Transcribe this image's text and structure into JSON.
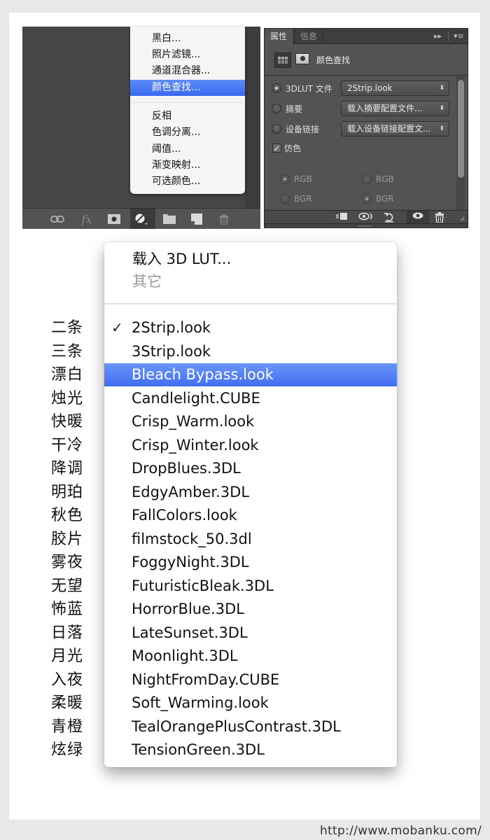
{
  "adjustment_menu": {
    "items_top": [
      "黑白...",
      "照片滤镜...",
      "通道混合器...",
      "颜色查找..."
    ],
    "selected": "颜色查找...",
    "items_bottom": [
      "反相",
      "色调分离...",
      "阈值...",
      "渐变映射...",
      "可选颜色..."
    ]
  },
  "layers_toolbar": {
    "icons": [
      "link-icon",
      "fx-icon",
      "mask-icon",
      "adjustment-icon",
      "folder-icon",
      "new-layer-icon",
      "trash-icon"
    ],
    "fx_label": "fx"
  },
  "properties_panel": {
    "tabs": [
      "属性",
      "信息"
    ],
    "active_tab": "属性",
    "title": "颜色查找",
    "rows": [
      {
        "label": "3DLUT 文件",
        "value": "2Strip.look",
        "selected": true
      },
      {
        "label": "摘要",
        "value": "载入摘要配置文件...",
        "selected": false
      },
      {
        "label": "设备链接",
        "value": "载入设备链接配置文...",
        "selected": false
      }
    ],
    "dither_label": "仿色",
    "dither_checked": true,
    "order_left": [
      {
        "label": "RGB",
        "selected": true
      },
      {
        "label": "BGR",
        "selected": false
      }
    ],
    "order_right": [
      {
        "label": "RGB",
        "selected": false
      },
      {
        "label": "BGR",
        "selected": true
      }
    ],
    "select_arrows": "⬍"
  },
  "lut_dropdown": {
    "load_label": "载入 3D LUT...",
    "other_label": "其它",
    "checked": "2Strip.look",
    "highlighted": "Bleach Bypass.look",
    "items": [
      "2Strip.look",
      "3Strip.look",
      "Bleach Bypass.look",
      "Candlelight.CUBE",
      "Crisp_Warm.look",
      "Crisp_Winter.look",
      "DropBlues.3DL",
      "EdgyAmber.3DL",
      "FallColors.look",
      "filmstock_50.3dl",
      "FoggyNight.3DL",
      "FuturisticBleak.3DL",
      "HorrorBlue.3DL",
      "LateSunset.3DL",
      "Moonlight.3DL",
      "NightFromDay.CUBE",
      "Soft_Warming.look",
      "TealOrangePlusContrast.3DL",
      "TensionGreen.3DL"
    ]
  },
  "chinese_names": [
    "二条",
    "三条",
    "漂白",
    "烛光",
    "快暖",
    "干冷",
    "降调",
    "明珀",
    "秋色",
    "胶片",
    "雾夜",
    "无望",
    "怖蓝",
    "日落",
    "月光",
    "入夜",
    "柔暖",
    "青橙",
    "炫绿"
  ],
  "footer": {
    "url": "http://www.mobanku.com/"
  },
  "colors": {
    "highlight": "#3f6ef2",
    "panel": "#535353"
  }
}
